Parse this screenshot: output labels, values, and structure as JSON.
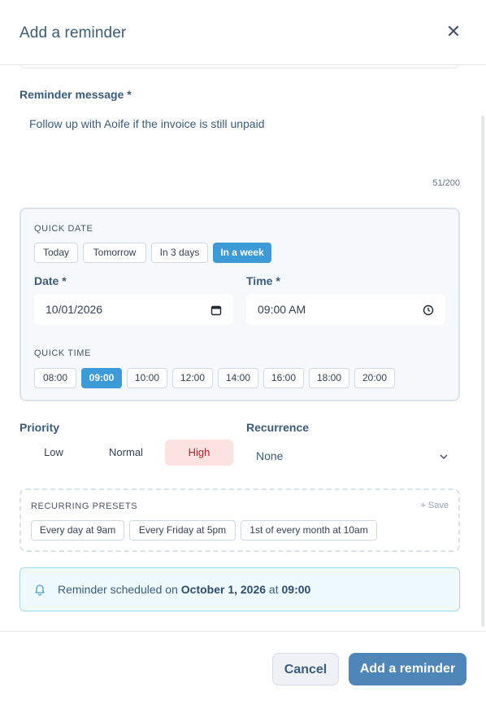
{
  "dialog": {
    "title": "Add a reminder",
    "close_icon": "close-icon"
  },
  "message": {
    "label": "Reminder message *",
    "value": "Follow up with Aoife if the invoice is still unpaid",
    "counter": "51/200"
  },
  "quick_date": {
    "caption": "QUICK DATE",
    "options": [
      "Today",
      "Tomorrow",
      "In 3 days",
      "In a week"
    ],
    "selected": "In a week"
  },
  "date": {
    "label": "Date *",
    "value": "10/01/2026",
    "icon": "calendar-icon"
  },
  "time": {
    "label": "Time *",
    "value": "09:00 AM",
    "icon": "clock-icon"
  },
  "quick_time": {
    "caption": "QUICK TIME",
    "options": [
      "08:00",
      "09:00",
      "10:00",
      "12:00",
      "14:00",
      "16:00",
      "18:00",
      "20:00"
    ],
    "selected": "09:00"
  },
  "priority": {
    "label": "Priority",
    "options": [
      "Low",
      "Normal",
      "High"
    ],
    "selected": "High"
  },
  "recurrence": {
    "label": "Recurrence",
    "value": "None",
    "icon": "chevron-down-icon"
  },
  "recurring_presets": {
    "caption": "RECURRING PRESETS",
    "save_label": "+ Save",
    "items": [
      "Every day at 9am",
      "Every Friday at 5pm",
      "1st of every month at 10am"
    ]
  },
  "notice": {
    "icon": "bell-icon",
    "prefix": "Reminder scheduled on ",
    "date": "October 1, 2026",
    "middle": " at ",
    "time": "09:00"
  },
  "footer": {
    "cancel_label": "Cancel",
    "submit_label": "Add a reminder"
  },
  "colors": {
    "accent": "#3c9ad6",
    "primary_button": "#4e86b8",
    "high_priority_bg": "#fde2e2",
    "high_priority_text": "#b91c1c",
    "notice_bg": "#effaff"
  }
}
